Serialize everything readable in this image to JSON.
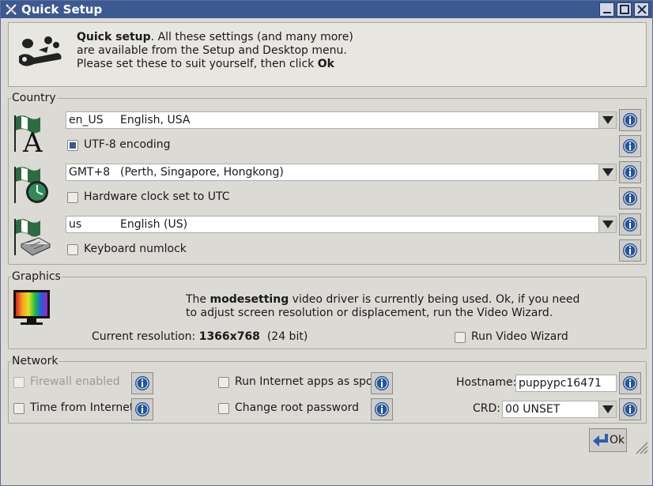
{
  "window": {
    "title": "Quick Setup"
  },
  "header": {
    "bold_title": "Quick setup",
    "line1_rest": ". All these settings (and many more)",
    "line2": "are available from the Setup and Desktop menu.",
    "line3_prefix": "Please set these to suit yourself, then click ",
    "line3_bold": "Ok"
  },
  "country": {
    "legend": "Country",
    "locale": {
      "code": "en_US",
      "name": "English, USA"
    },
    "utf8": {
      "label": "UTF-8 encoding",
      "checked": true
    },
    "timezone": {
      "code": "GMT+8",
      "name": "(Perth, Singapore, Hongkong)"
    },
    "hwclock": {
      "label": "Hardware clock set to UTC",
      "checked": false
    },
    "keyboard": {
      "code": "us",
      "name": "English (US)"
    },
    "numlock": {
      "label": "Keyboard numlock",
      "checked": false
    }
  },
  "graphics": {
    "legend": "Graphics",
    "desc_pre": "The ",
    "driver": "modesetting",
    "desc_post": " video driver is currently being used. Ok, if you need",
    "desc_line2": "to adjust screen resolution or displacement, run the Video Wizard.",
    "res_label": "Current resolution: ",
    "resolution": "1366x768",
    "depth": "(24 bit)",
    "wizard": {
      "label": "Run Video Wizard",
      "checked": false
    }
  },
  "network": {
    "legend": "Network",
    "firewall": {
      "label": "Firewall enabled",
      "checked": false,
      "disabled": true
    },
    "time_internet": {
      "label": "Time from Internet",
      "checked": false
    },
    "spot": {
      "label": "Run Internet apps as spot",
      "checked": false
    },
    "rootpw": {
      "label": "Change root password",
      "checked": false
    },
    "hostname_label": "Hostname:",
    "hostname_value": "puppypc16471",
    "crd_label": "CRD:",
    "crd_value": "00 UNSET"
  },
  "ok_label": "Ok",
  "colors": {
    "titlebar": "#3b5a93",
    "background": "#dcdad5",
    "accent": "#3b5a93"
  }
}
